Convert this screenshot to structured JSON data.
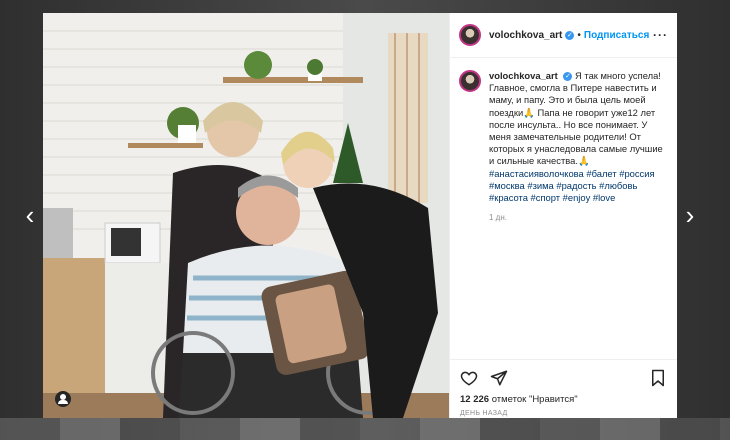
{
  "post": {
    "username": "volochkova_art",
    "verified_mark": "✓",
    "follow_separator": "•",
    "follow_label": "Подписаться",
    "more_label": "···",
    "caption_text": "Я так много успела! Главное, смогла в Питере навестить и маму, и папу. Это и была цель моей поездки🙏 Папа не говорит уже12 лет после инсульта.. Но все понимает. У меня замечательные родители! От которых я унаследовала самые лучшие и сильные качества.🙏",
    "hashtags": "#анастасияволочкова #балет #россия #москва #зима #радость #любовь #красота #спорт #enjoy #love",
    "caption_time": "1 дн.",
    "likes_count": "12 226",
    "likes_text": "отметок \"Нравится\"",
    "post_date": "ДЕНЬ НАЗАД"
  },
  "navigation": {
    "prev_arrow": "‹",
    "next_arrow": "›"
  },
  "icons": {
    "like": "heart-icon",
    "share": "paper-plane-icon",
    "save": "bookmark-icon",
    "user_tags": "user-tag-icon",
    "verified": "verified-badge-icon",
    "more": "more-options-icon"
  },
  "colors": {
    "link": "#0095f6",
    "hashtag": "#00376b",
    "verified": "#3897f0",
    "text": "#262626",
    "muted": "#8e8e8e"
  }
}
